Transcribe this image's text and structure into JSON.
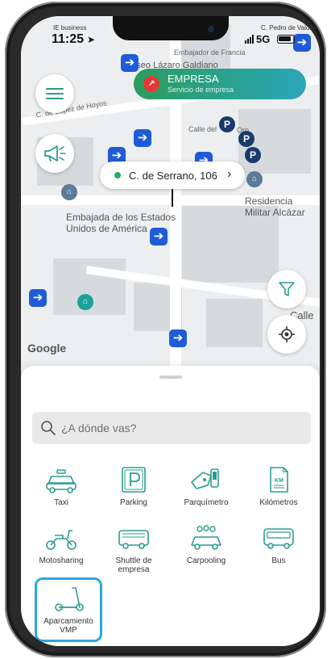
{
  "status": {
    "time": "11:25",
    "carrier_left": "IE business",
    "carrier_right": "C. Pedro de Valdiv",
    "network": "5G"
  },
  "map": {
    "labels": {
      "embajador": "Embajador de Francia",
      "museo": "Museo Lázaro Galdiano",
      "lopez": "C. de López de Hoyos",
      "calle_del": "Calle del",
      "oro": "Oro",
      "residencia": "Residencia\nMilitar Alcázar",
      "embajada": "Embajada de los Estados\nUnidos de América",
      "calle": "Calle"
    },
    "google": "Google"
  },
  "empresa": {
    "title": "EMPRESA",
    "subtitle": "Servicio de empresa"
  },
  "address": {
    "text": "C. de Serrano, 106"
  },
  "search": {
    "placeholder": "¿A dónde vas?"
  },
  "services": [
    {
      "label": "Taxi",
      "icon": "taxi-icon"
    },
    {
      "label": "Parking",
      "icon": "parking-icon"
    },
    {
      "label": "Parquímetro",
      "icon": "parking-meter-icon"
    },
    {
      "label": "Kilómetros",
      "icon": "kilometers-icon"
    },
    {
      "label": "Motosharing",
      "icon": "scooter-icon"
    },
    {
      "label": "Shuttle de empresa",
      "icon": "shuttle-icon"
    },
    {
      "label": "Carpooling",
      "icon": "carpooling-icon"
    },
    {
      "label": "Bus",
      "icon": "bus-icon"
    },
    {
      "label": "Aparcamiento VMP",
      "icon": "kick-scooter-icon"
    }
  ],
  "colors": {
    "accent": "#2a9d8f",
    "highlight": "#29a8e0",
    "metro": "#1f5bd6"
  }
}
